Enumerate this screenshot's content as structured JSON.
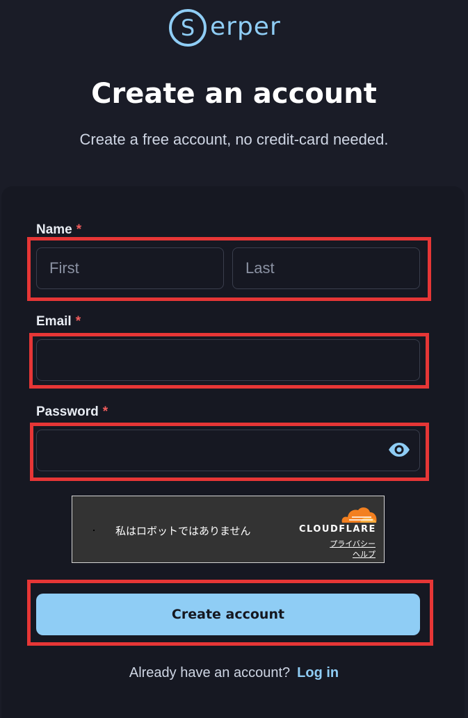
{
  "brand": {
    "logo_letter": "S",
    "logo_text": "erper"
  },
  "header": {
    "title": "Create an account",
    "subtitle": "Create a free account, no credit-card needed."
  },
  "form": {
    "name": {
      "label": "Name",
      "required_marker": "*",
      "first_placeholder": "First",
      "last_placeholder": "Last",
      "first_value": "",
      "last_value": ""
    },
    "email": {
      "label": "Email",
      "required_marker": "*",
      "value": "",
      "placeholder": ""
    },
    "password": {
      "label": "Password",
      "required_marker": "*",
      "value": "",
      "placeholder": "",
      "toggle_icon": "eye-icon"
    },
    "captcha": {
      "text": "私はロボットではありません",
      "brand": "CLOUDFLARE",
      "privacy": "プライバシー",
      "help": "ヘルプ"
    },
    "submit_label": "Create account"
  },
  "footer": {
    "prompt": "Already have an account?",
    "login_label": "Log in"
  },
  "colors": {
    "background": "#1a1c27",
    "accent": "#8fcdf5",
    "required": "#f05c5c",
    "highlight_box": "#e63636",
    "cloudflare_orange": "#f38020"
  }
}
